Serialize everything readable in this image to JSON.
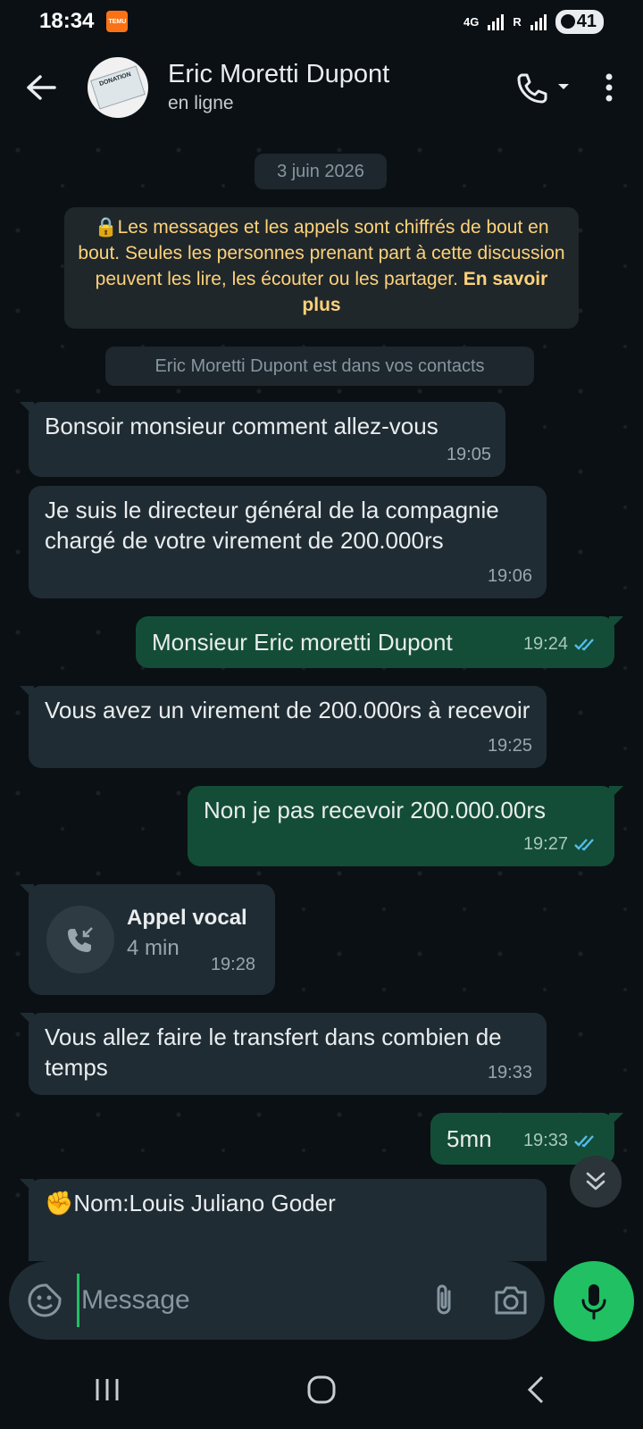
{
  "status_bar": {
    "time": "18:34",
    "badge": "TEMU",
    "network": "4G",
    "sim_label": "R",
    "battery": "41"
  },
  "header": {
    "contact_name": "Eric Moretti Dupont",
    "status": "en ligne",
    "avatar_text": "DONATION"
  },
  "chat": {
    "date": "3 juin 2026",
    "encryption_notice": "Les messages et les appels sont chiffrés de bout en bout. Seules les personnes prenant part à cette discussion peuvent les lire, les écouter ou les partager.",
    "encryption_link": "En savoir plus",
    "contact_notice": "Eric Moretti Dupont est dans vos contacts",
    "messages": [
      {
        "dir": "in",
        "text": "Bonsoir monsieur comment allez-vous",
        "time": "19:05"
      },
      {
        "dir": "in",
        "text": "Je suis le directeur général de la compagnie chargé de votre virement de 200.000rs",
        "time": "19:06"
      },
      {
        "dir": "out",
        "text": "Monsieur Eric moretti Dupont",
        "time": "19:24"
      },
      {
        "dir": "in",
        "text": "Vous avez un virement de 200.000rs à recevoir",
        "time": "19:25"
      },
      {
        "dir": "out",
        "text": "Non je pas recevoir 200.000.00rs",
        "time": "19:27"
      },
      {
        "dir": "in",
        "text": "Vous allez faire le transfert dans combien de temps",
        "time": "19:33"
      },
      {
        "dir": "out",
        "text": "5mn",
        "time": "19:33"
      },
      {
        "dir": "in",
        "text": "✊Nom:Louis Juliano Goder",
        "time": ""
      }
    ],
    "call": {
      "title": "Appel vocal",
      "duration": "4 min",
      "time": "19:28"
    }
  },
  "input": {
    "placeholder": "Message"
  },
  "colors": {
    "accent": "#21c063",
    "outgoing": "#144d37",
    "incoming": "#202c33",
    "notice": "#ffd279"
  }
}
